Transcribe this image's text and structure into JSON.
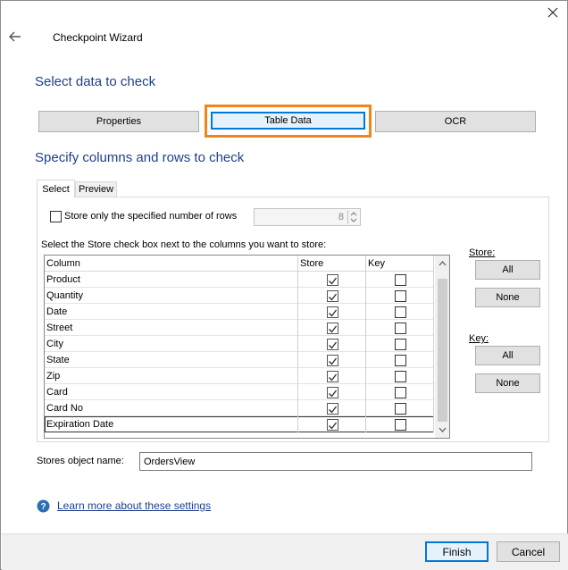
{
  "window": {
    "title": "Checkpoint Wizard"
  },
  "sections": {
    "select_data": "Select data to check",
    "specify_columns": "Specify columns and rows to check"
  },
  "data_tabs": [
    {
      "label": "Properties",
      "selected": false
    },
    {
      "label": "Table Data",
      "selected": true
    },
    {
      "label": "OCR",
      "selected": false
    }
  ],
  "panel_tabs": [
    {
      "label": "Select",
      "active": true
    },
    {
      "label": "Preview",
      "active": false
    }
  ],
  "rows_option": {
    "label": "Store only the specified number of rows",
    "checked": false,
    "count": "8"
  },
  "instruction": "Select the Store check box next to the columns you want to store:",
  "grid": {
    "headers": {
      "column": "Column",
      "store": "Store",
      "key": "Key"
    },
    "rows": [
      {
        "column": "Product",
        "store": true,
        "key": false
      },
      {
        "column": "Quantity",
        "store": true,
        "key": false
      },
      {
        "column": "Date",
        "store": true,
        "key": false
      },
      {
        "column": "Street",
        "store": true,
        "key": false
      },
      {
        "column": "City",
        "store": true,
        "key": false
      },
      {
        "column": "State",
        "store": true,
        "key": false
      },
      {
        "column": "Zip",
        "store": true,
        "key": false
      },
      {
        "column": "Card",
        "store": true,
        "key": false
      },
      {
        "column": "Card No",
        "store": true,
        "key": false
      },
      {
        "column": "Expiration Date",
        "store": true,
        "key": false
      }
    ]
  },
  "store_group": {
    "label": "Store:",
    "all": "All",
    "none": "None"
  },
  "key_group": {
    "label": "Key:",
    "all": "All",
    "none": "None"
  },
  "object_name": {
    "label": "Stores object name:",
    "value": "OrdersView"
  },
  "help_link": "Learn more about these settings",
  "footer": {
    "finish": "Finish",
    "cancel": "Cancel"
  },
  "colors": {
    "accent": "#0078d7",
    "highlight": "#f0851b",
    "heading": "#1e3f8e"
  }
}
